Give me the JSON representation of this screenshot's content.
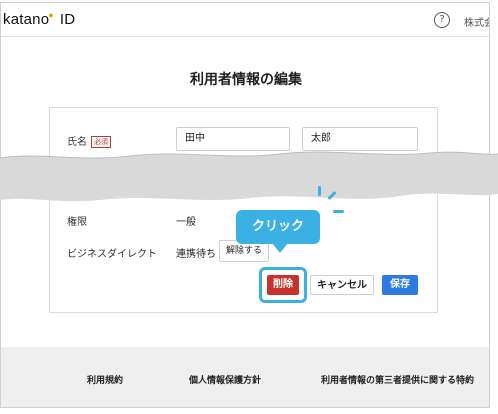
{
  "header": {
    "logo_text": "katano",
    "logo_suffix": "ID",
    "help_icon_glyph": "?",
    "company_text": "株式会"
  },
  "page": {
    "title": "利用者情報の編集"
  },
  "form": {
    "name_label": "氏名",
    "required_badge": "必須",
    "last_name_value": "田中",
    "first_name_value": "太郎",
    "permission_label": "権限",
    "permission_value": "一般",
    "business_direct_label": "ビジネスダイレクト",
    "business_direct_status": "連携待ち",
    "unlink_button": "解除する"
  },
  "actions": {
    "delete_label": "削除",
    "cancel_label": "キャンセル",
    "save_label": "保存"
  },
  "annotation": {
    "click_label": "クリック"
  },
  "footer": {
    "terms": "利用規約",
    "privacy": "個人情報保護方針",
    "third_party": "利用者情報の第三者提供に関する特約"
  },
  "colors": {
    "delete": "#c9322c",
    "save": "#2d7be0",
    "highlight": "#3ab0e5",
    "required": "#c8332d"
  }
}
